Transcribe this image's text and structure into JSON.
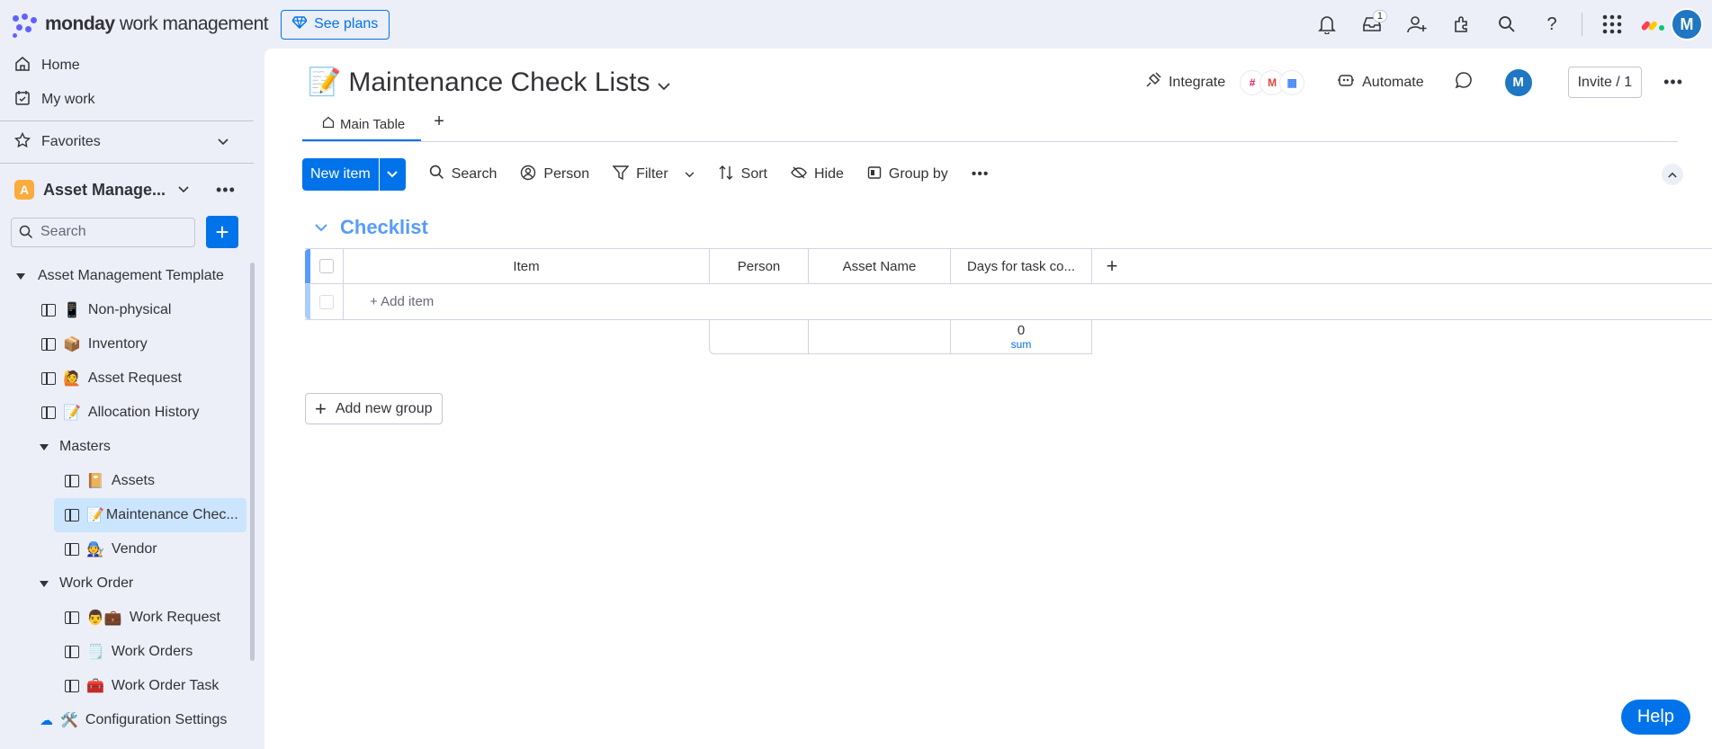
{
  "brand": {
    "name_bold": "monday",
    "name_rest": " work management"
  },
  "top": {
    "see_plans": "See plans",
    "inbox_badge": "1",
    "avatar": "M"
  },
  "sidebar": {
    "home": "Home",
    "my_work": "My work",
    "favorites": "Favorites",
    "workspace_badge": "A",
    "workspace_name": "Asset Manage...",
    "search_placeholder": "Search",
    "tree": [
      {
        "label": "Asset Management Template"
      },
      {
        "emoji": "📱",
        "label": "Non-physical"
      },
      {
        "emoji": "📦",
        "label": "Inventory"
      },
      {
        "emoji": "🙋",
        "label": "Asset Request"
      },
      {
        "emoji": "📝",
        "label": "Allocation History"
      },
      {
        "label": "Masters"
      },
      {
        "emoji": "📔",
        "label": "Assets"
      },
      {
        "emoji": "📝",
        "label": "Maintenance Chec..."
      },
      {
        "emoji": "🧑‍🔧",
        "label": "Vendor"
      },
      {
        "label": "Work Order"
      },
      {
        "emoji": "👨💼",
        "label": "Work Request"
      },
      {
        "emoji": "🗒️",
        "label": "Work Orders"
      },
      {
        "emoji": "🧰",
        "label": "Work Order Task"
      },
      {
        "emoji": "🛠️",
        "label": "Configuration Settings"
      }
    ]
  },
  "board": {
    "emoji": "📝",
    "title": "Maintenance Check Lists",
    "integrate": "Integrate",
    "automate": "Automate",
    "avatar": "M",
    "invite": "Invite / 1",
    "tab": "Main Table",
    "toolbar": {
      "new_item": "New item",
      "search": "Search",
      "person": "Person",
      "filter": "Filter",
      "sort": "Sort",
      "hide": "Hide",
      "group_by": "Group by"
    },
    "group": {
      "title": "Checklist",
      "columns": [
        "Item",
        "Person",
        "Asset Name",
        "Days for task co..."
      ],
      "add_item": "+ Add item",
      "sum_value": "0",
      "sum_label": "sum"
    },
    "add_new_group": "Add new group",
    "help": "Help"
  },
  "colors": {
    "accent": "#0073ea",
    "group": "#579bfc",
    "workspace": "#fdab3d"
  }
}
